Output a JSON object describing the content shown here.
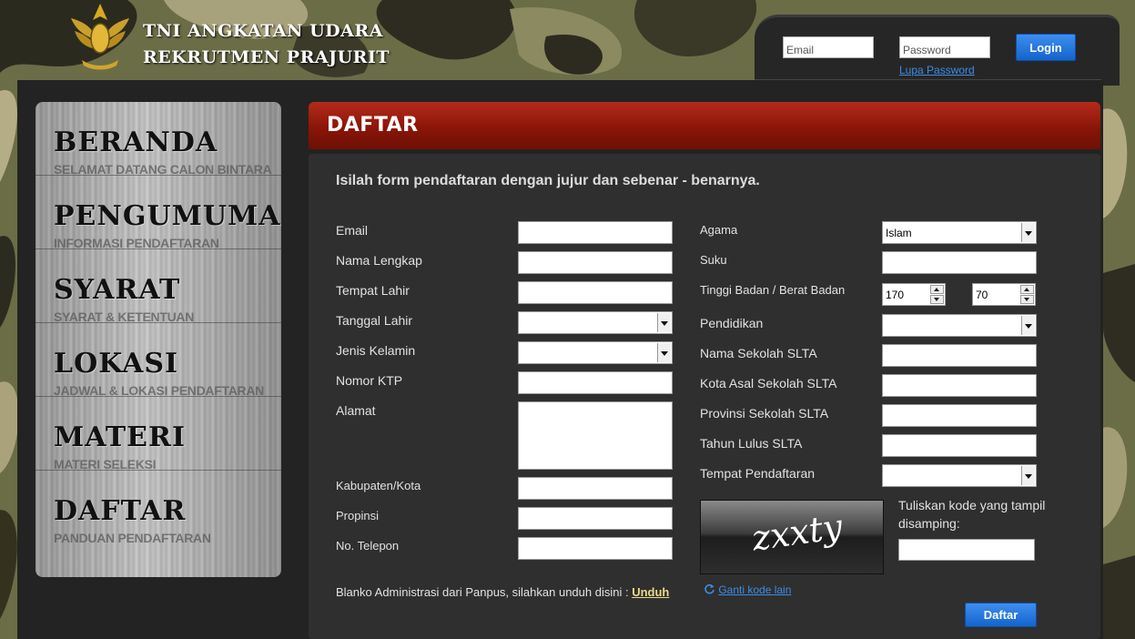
{
  "header": {
    "title_line1": "TNI ANGKATAN UDARA",
    "title_line2": "REKRUTMEN PRAJURIT",
    "logo_icon": "air-force-emblem-icon"
  },
  "login": {
    "email_placeholder": "Email",
    "password_placeholder": "Password",
    "login_label": "Login",
    "forgot_label": "Lupa Password"
  },
  "sidebar": {
    "items": [
      {
        "title": "BERANDA",
        "subtitle": "SELAMAT DATANG CALON BINTARA"
      },
      {
        "title": "PENGUMUMAN",
        "subtitle": "INFORMASI PENDAFTARAN"
      },
      {
        "title": "SYARAT",
        "subtitle": "SYARAT & KETENTUAN"
      },
      {
        "title": "LOKASI",
        "subtitle": "JADWAL & LOKASI PENDAFTARAN"
      },
      {
        "title": "MATERI",
        "subtitle": "MATERI SELEKSI"
      },
      {
        "title": "DAFTAR",
        "subtitle": "PANDUAN PENDAFTARAN"
      }
    ]
  },
  "page": {
    "heading": "DAFTAR",
    "intro": "Isilah form pendaftaran dengan jujur dan sebenar - benarnya."
  },
  "form_left": {
    "email": "Email",
    "nama_lengkap": "Nama Lengkap",
    "tempat_lahir": "Tempat Lahir",
    "tanggal_lahir": "Tanggal Lahir",
    "jenis_kelamin": "Jenis Kelamin",
    "nomor_ktp": "Nomor KTP",
    "alamat": "Alamat",
    "kabupaten": "Kabupaten/Kota",
    "propinsi": "Propinsi",
    "telepon": "No. Telepon"
  },
  "form_right": {
    "agama": "Agama",
    "agama_value": "Islam",
    "suku": "Suku",
    "tinggi_berat": "Tinggi Badan / Berat Badan",
    "tinggi_value": "170",
    "berat_value": "70",
    "pendidikan": "Pendidikan",
    "nama_sekolah": "Nama Sekolah SLTA",
    "kota_sekolah": "Kota Asal Sekolah SLTA",
    "provinsi_sekolah": "Provinsi Sekolah SLTA",
    "tahun_lulus": "Tahun Lulus SLTA",
    "tempat_pendaftaran": "Tempat Pendaftaran"
  },
  "captcha": {
    "code": "zxxty",
    "help": "Tuliskan kode yang tampil disamping:",
    "refresh_label": "Ganti kode lain"
  },
  "footer": {
    "blanko_text": "Blanko Administrasi dari Panpus, silahkan unduh disini : ",
    "unduh_label": "Unduh",
    "submit_label": "Daftar"
  },
  "colors": {
    "header_red": "#9a1c0c",
    "button_blue": "#1f72e0",
    "link_blue": "#3d8ce6",
    "background_dark": "#232323"
  }
}
